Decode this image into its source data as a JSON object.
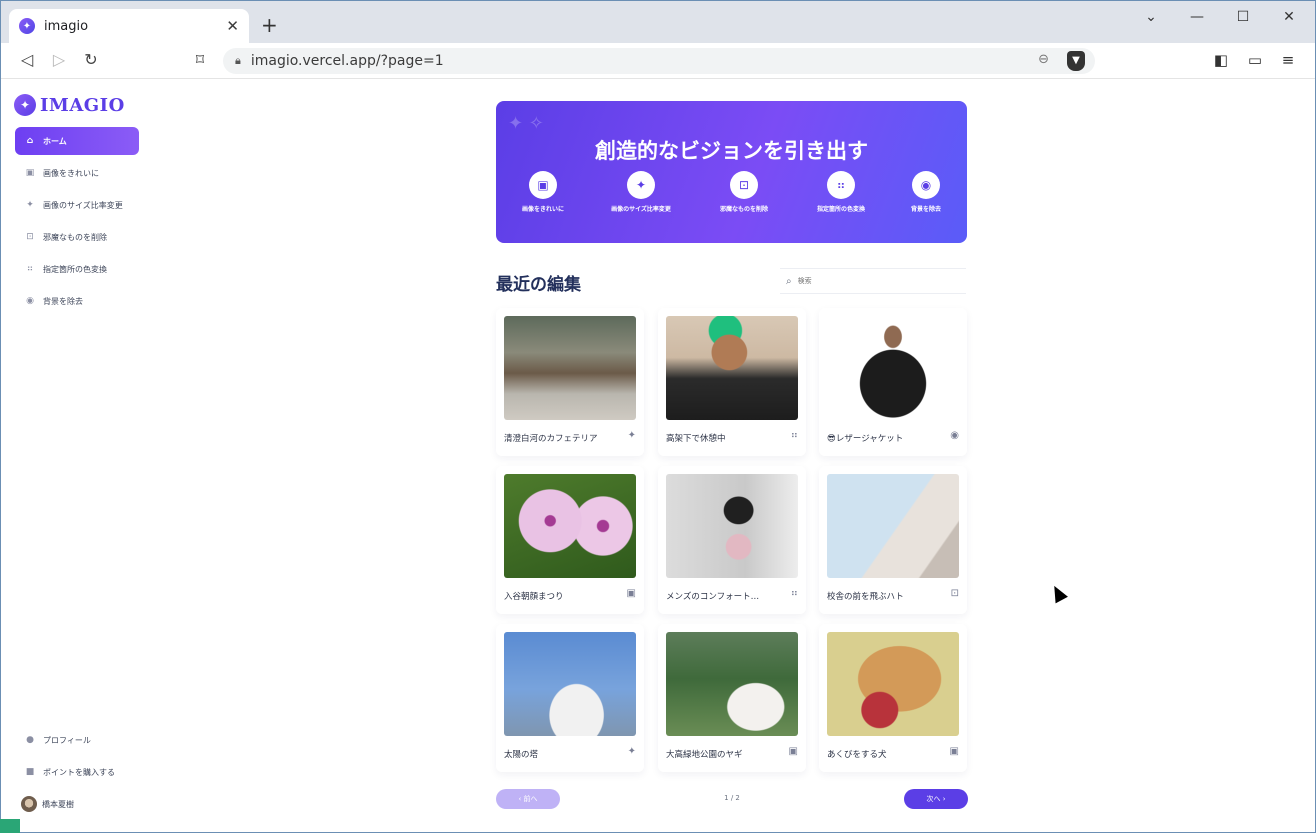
{
  "browser": {
    "tab_title": "imagio",
    "tab_close": "✕",
    "new_tab": "+",
    "url": "imagio.vercel.app/?page=1",
    "window_controls": {
      "minimize": "—",
      "maximize": "☐",
      "close": "✕",
      "list": "⌄"
    }
  },
  "app": {
    "logo_text": "IMAGIO",
    "brand_color": "#5b3ee6"
  },
  "sidebar": {
    "items": [
      {
        "label": "ホーム",
        "icon": "home-icon",
        "glyph": "⌂",
        "active": true
      },
      {
        "label": "画像をきれいに",
        "icon": "image-icon",
        "glyph": "▣",
        "active": false
      },
      {
        "label": "画像のサイズ比率変更",
        "icon": "sparkle-icon",
        "glyph": "✦",
        "active": false
      },
      {
        "label": "邪魔なものを削除",
        "icon": "erase-icon",
        "glyph": "⊡",
        "active": false
      },
      {
        "label": "指定箇所の色変換",
        "icon": "color-swap-icon",
        "glyph": "⠶",
        "active": false
      },
      {
        "label": "背景を除去",
        "icon": "camera-icon",
        "glyph": "◉",
        "active": false
      }
    ],
    "bottom": {
      "profile": "プロフィール",
      "buy_points": "ポイントを購入する",
      "user_name": "橋本夏樹"
    }
  },
  "hero": {
    "title": "創造的なビジョンを引き出す",
    "features": [
      {
        "label": "画像をきれいに",
        "icon": "image-icon",
        "glyph": "▣"
      },
      {
        "label": "画像のサイズ比率変更",
        "icon": "sparkle-icon",
        "glyph": "✦"
      },
      {
        "label": "邪魔なものを削除",
        "icon": "erase-icon",
        "glyph": "⊡"
      },
      {
        "label": "指定箇所の色変換",
        "icon": "color-swap-icon",
        "glyph": "⠶"
      },
      {
        "label": "背景を除去",
        "icon": "camera-icon",
        "glyph": "◉"
      }
    ]
  },
  "recent": {
    "title": "最近の編集",
    "search_placeholder": "検索",
    "items": [
      {
        "title": "清澄白河のカフェテリア",
        "icon": "sparkle-icon",
        "glyph": "✦"
      },
      {
        "title": "高架下で休憩中",
        "icon": "color-swap-icon",
        "glyph": "⠶"
      },
      {
        "title": "😎レザージャケット",
        "icon": "camera-icon",
        "glyph": "◉"
      },
      {
        "title": "入谷朝顔まつり",
        "icon": "image-icon",
        "glyph": "▣"
      },
      {
        "title": "メンズのコンフォート…",
        "icon": "color-swap-icon",
        "glyph": "⠶"
      },
      {
        "title": "校舎の前を飛ぶハト",
        "icon": "erase-icon",
        "glyph": "⊡"
      },
      {
        "title": "太陽の塔",
        "icon": "sparkle-icon",
        "glyph": "✦"
      },
      {
        "title": "大高緑地公園のヤギ",
        "icon": "image-icon",
        "glyph": "▣"
      },
      {
        "title": "あくびをする犬",
        "icon": "image-icon",
        "glyph": "▣"
      }
    ]
  },
  "pagination": {
    "prev": "‹ 前へ",
    "next": "次へ ›",
    "indicator": "1 / 2"
  }
}
